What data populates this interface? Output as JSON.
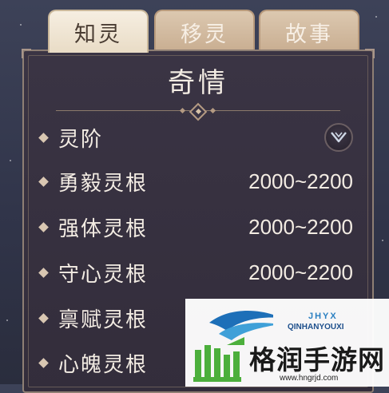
{
  "tabs": [
    {
      "label": "知灵",
      "active": true
    },
    {
      "label": "移灵",
      "active": false
    },
    {
      "label": "故事",
      "active": false
    }
  ],
  "panel": {
    "title": "奇情",
    "rows": [
      {
        "label": "灵阶",
        "value": ""
      },
      {
        "label": "勇毅灵根",
        "value": "2000~2200"
      },
      {
        "label": "强体灵根",
        "value": "2000~2200"
      },
      {
        "label": "守心灵根",
        "value": "2000~2200"
      },
      {
        "label": "禀赋灵根",
        "value": ""
      },
      {
        "label": "心魄灵根",
        "value": ""
      }
    ]
  },
  "watermark": {
    "brand_en_short": "JHYX",
    "brand_en": "QINHANYOUXI",
    "brand_cn": "格润手游网",
    "url": "www.hngrjd.com"
  },
  "colors": {
    "tab_active_bg": "#f0e6d6",
    "tab_inactive_bg": "#d2b89c",
    "panel_bg": "#352f3f",
    "text": "#f3ece3",
    "logo_green": "#4caf3c",
    "logo_blue": "#1d6fb8"
  }
}
